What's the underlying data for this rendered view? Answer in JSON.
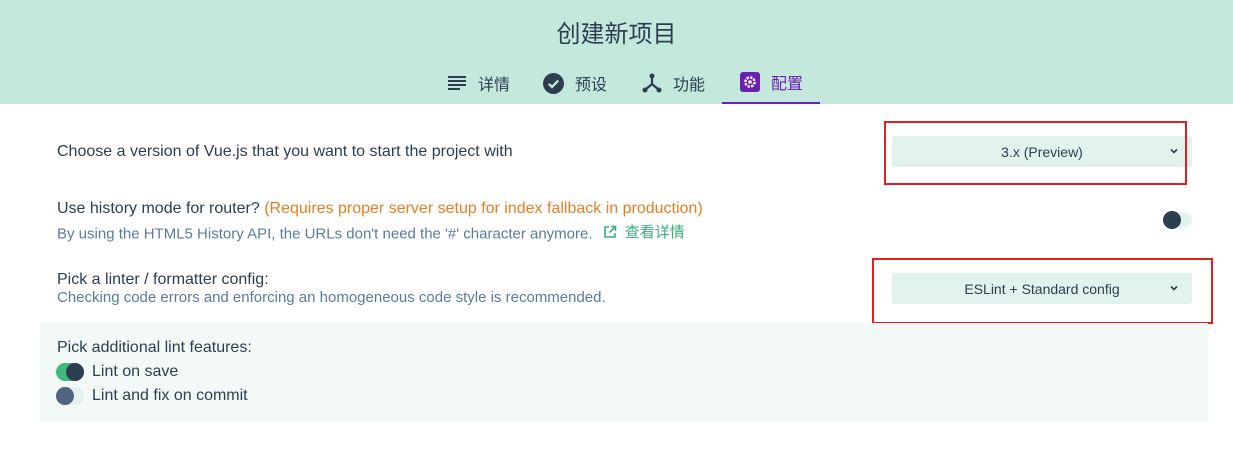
{
  "header": {
    "title": "创建新项目",
    "tabs": [
      {
        "label": "详情",
        "icon": "list-icon"
      },
      {
        "label": "预设",
        "icon": "check-circle-icon"
      },
      {
        "label": "功能",
        "icon": "fork-icon"
      },
      {
        "label": "配置",
        "icon": "gear-icon",
        "active": true
      }
    ]
  },
  "vue_version": {
    "label": "Choose a version of Vue.js that you want to start the project with",
    "selected": "3.x (Preview)"
  },
  "history_mode": {
    "label": "Use history mode for router?",
    "warning": "(Requires proper server setup for index fallback in production)",
    "description": "By using the HTML5 History API, the URLs don't need the '#' character anymore.",
    "more_link": "查看详情",
    "enabled": false
  },
  "linter": {
    "label": "Pick a linter / formatter config:",
    "description": "Checking code errors and enforcing an homogeneous code style is recommended.",
    "selected": "ESLint + Standard config"
  },
  "lint_features": {
    "label": "Pick additional lint features:",
    "options": [
      {
        "label": "Lint on save",
        "checked": true
      },
      {
        "label": "Lint and fix on commit",
        "checked": false
      }
    ]
  },
  "colors": {
    "header_bg": "#c5e8dd",
    "accent": "#6a1fb5",
    "primary_green": "#42b983",
    "warning": "#e67e22",
    "annotation": "#e02020"
  }
}
